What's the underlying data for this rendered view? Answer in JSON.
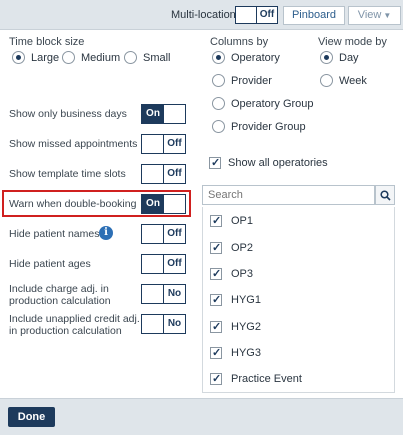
{
  "topbar": {
    "multi_location_label": "Multi-location",
    "multi_location_state": "Off",
    "pinboard_label": "Pinboard",
    "view_label": "View"
  },
  "time_block": {
    "title": "Time block size",
    "options": [
      "Large",
      "Medium",
      "Small"
    ],
    "selected": "Large"
  },
  "columns_by": {
    "title": "Columns by",
    "options": [
      "Operatory",
      "Provider",
      "Operatory Group",
      "Provider Group"
    ],
    "selected": "Operatory"
  },
  "view_mode": {
    "title": "View mode by",
    "options": [
      "Day",
      "Week"
    ],
    "selected": "Day"
  },
  "settings": [
    {
      "label": "Show only business days",
      "state": "On"
    },
    {
      "label": "Show missed appointments",
      "state": "Off"
    },
    {
      "label": "Show template time slots",
      "state": "Off"
    },
    {
      "label": "Warn when double-booking",
      "state": "On"
    },
    {
      "label": "Hide patient names",
      "state": "Off"
    },
    {
      "label": "Hide patient ages",
      "state": "Off"
    },
    {
      "label_line1": "Include charge adj. in",
      "label_line2": "production calculation",
      "state": "No"
    },
    {
      "label_line1": "Include unapplied credit adj.",
      "label_line2": "in production calculation",
      "state": "No"
    }
  ],
  "show_all_operatories": {
    "label": "Show all operatories",
    "checked": true
  },
  "search": {
    "placeholder": "Search"
  },
  "operatories": [
    {
      "label": "OP1",
      "checked": true
    },
    {
      "label": "OP2",
      "checked": true
    },
    {
      "label": "OP3",
      "checked": true
    },
    {
      "label": "HYG1",
      "checked": true
    },
    {
      "label": "HYG2",
      "checked": true
    },
    {
      "label": "HYG3",
      "checked": true
    },
    {
      "label": "Practice Event",
      "checked": true
    }
  ],
  "footer": {
    "done_label": "Done"
  },
  "colors": {
    "navy": "#1d3a5c",
    "highlight": "#d0201f",
    "info": "#2c6fb5",
    "bar": "#dfe5ea"
  }
}
